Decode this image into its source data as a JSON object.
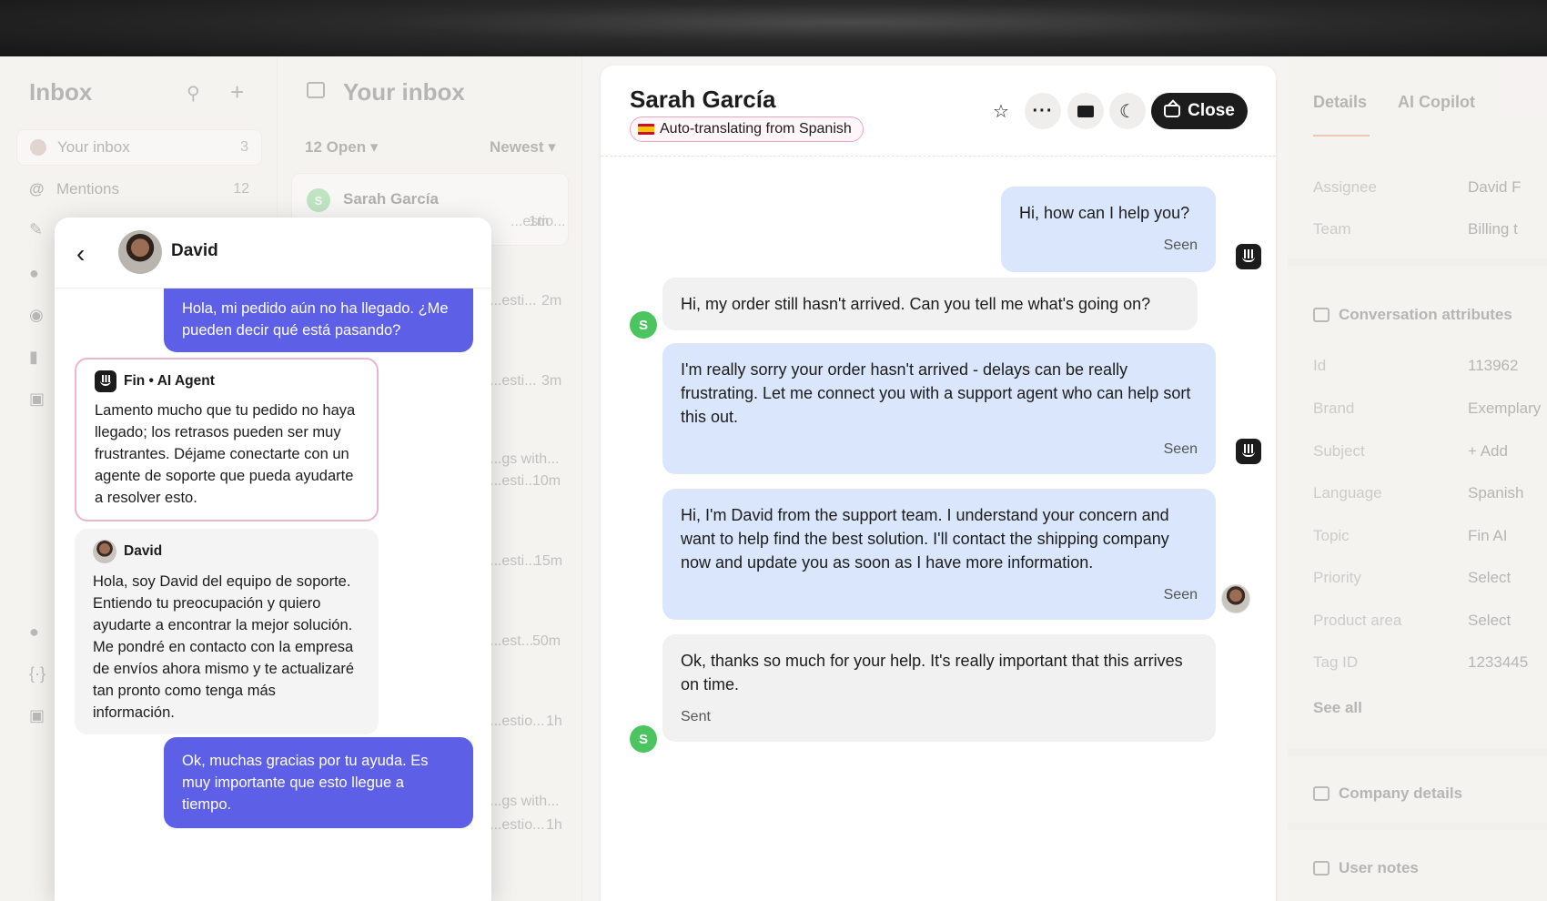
{
  "sidebar": {
    "title": "Inbox",
    "items": [
      {
        "label": "Your inbox",
        "count": "3"
      },
      {
        "label": "Mentions",
        "count": "12"
      }
    ]
  },
  "inbox_list": {
    "title": "Your inbox",
    "filter_open": "12 Open",
    "filter_sort": "Newest",
    "first_card": {
      "avatar": "S",
      "name": "Sarah García",
      "snippet": "...estio...",
      "time": "1m"
    },
    "rows": [
      {
        "snippet": "...esti...",
        "time": "2m"
      },
      {
        "snippet": "...esti...",
        "time": "3m"
      },
      {
        "snippet": "...gs with...",
        "snippet2": "...esti...",
        "time": "10m"
      },
      {
        "snippet": "...esti...",
        "time": "15m"
      },
      {
        "snippet": "...est...",
        "time": "50m"
      },
      {
        "snippet": "...estio...",
        "time": "1h"
      },
      {
        "snippet": "...gs with...",
        "snippet2": "...estio...",
        "time": "1h"
      }
    ]
  },
  "conversation": {
    "contact_name": "Sarah García",
    "translate_badge": "Auto-translating from Spanish",
    "close_label": "Close",
    "messages": [
      {
        "text": "Hi, how can I help you?",
        "status": "Seen"
      },
      {
        "text": "Hi, my order still hasn't arrived. Can you tell me what's going on?"
      },
      {
        "text": "I'm really sorry your order hasn't arrived - delays can be really frustrating. Let me connect you with a support agent who can help sort this out.",
        "status": "Seen"
      },
      {
        "text": "Hi, I'm David from the support team. I understand your concern and want to help find the best solution. I'll contact the shipping company now and update you as soon as I have more information.",
        "status": "Seen"
      },
      {
        "text": "Ok, thanks so much for your help. It's really important that this arrives on time.",
        "status": "Sent"
      }
    ],
    "customer_avatar": "S"
  },
  "details": {
    "tabs": [
      "Details",
      "AI Copilot"
    ],
    "assignee_label": "Assignee",
    "assignee_value": "David F",
    "team_label": "Team",
    "team_value": "Billing t",
    "section_attributes": "Conversation attributes",
    "attributes": [
      {
        "label": "Id",
        "value": "113962"
      },
      {
        "label": "Brand",
        "value": "Exemplary"
      },
      {
        "label": "Subject",
        "value": "+ Add"
      },
      {
        "label": "Language",
        "value": "Spanish"
      },
      {
        "label": "Topic",
        "value": "Fin AI"
      },
      {
        "label": "Priority",
        "value": "Select"
      },
      {
        "label": "Product area",
        "value": "Select"
      },
      {
        "label": "Tag ID",
        "value": "1233445"
      }
    ],
    "see_all": "See all",
    "section_company": "Company details",
    "section_notes": "User notes"
  },
  "messenger": {
    "agent_name": "David",
    "messages": [
      {
        "text": "Hola, mi pedido aún no ha llegado. ¿Me pueden decir qué está pasando?"
      },
      {
        "sender": "Fin • AI Agent",
        "text": "Lamento mucho que tu pedido no haya llegado; los retrasos pueden ser muy frustrantes. Déjame conectarte con un agente de soporte que pueda ayudarte a resolver esto."
      },
      {
        "sender": "David",
        "text": "Hola, soy David del equipo de soporte. Entiendo tu preocupación y quiero ayudarte a encontrar la mejor solución. Me pondré en contacto con la empresa de envíos ahora mismo y te actualizaré tan pronto como tenga más información."
      },
      {
        "text": "Ok, muchas gracias por tu ayuda. Es muy importante que esto llegue a tiempo."
      }
    ]
  }
}
